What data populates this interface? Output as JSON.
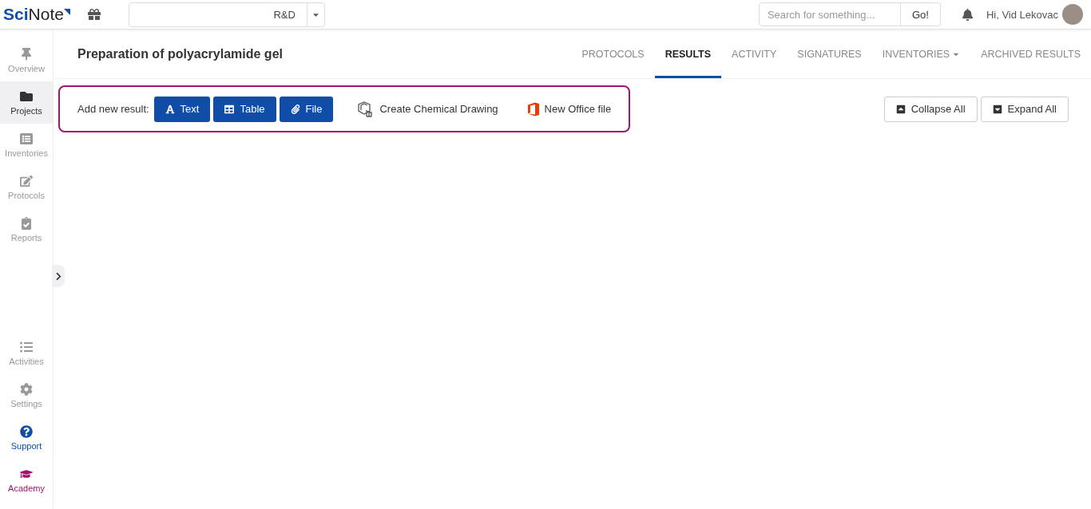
{
  "header": {
    "logo": "**Sci**Note",
    "team": "R&D",
    "search": {
      "placeholder": "Search for something..."
    },
    "search_button": "Go!",
    "greeting": "Hi, Vid Lekovac"
  },
  "sidebar": {
    "top_items": [
      {
        "label": "Overview",
        "selected": false
      },
      {
        "label": "Projects",
        "selected": true
      },
      {
        "label": "Inventories",
        "selected": false
      },
      {
        "label": "Protocols",
        "selected": false
      },
      {
        "label": "Reports",
        "selected": false
      }
    ],
    "bottom_items": [
      {
        "label": "Activities",
        "kind": "normal"
      },
      {
        "label": "Settings",
        "kind": "normal"
      },
      {
        "label": "Support",
        "kind": "support"
      },
      {
        "label": "Academy",
        "kind": "academy"
      }
    ]
  },
  "page": {
    "title": "Preparation of polyacrylamide gel",
    "tabs": [
      {
        "label": "PROTOCOLS",
        "selected": false
      },
      {
        "label": "RESULTS",
        "selected": true
      },
      {
        "label": "ACTIVITY",
        "selected": false
      },
      {
        "label": "SIGNATURES",
        "selected": false
      },
      {
        "label": "INVENTORIES",
        "selected": false,
        "dropdown": true
      },
      {
        "label": "ARCHIVED RESULTS",
        "selected": false
      }
    ],
    "add_result": {
      "label": "Add new result:",
      "buttons": [
        "Text",
        "Table",
        "File"
      ],
      "links": [
        "Create Chemical Drawing",
        "New Office file"
      ]
    },
    "actions": [
      "Collapse All",
      "Expand All"
    ]
  }
}
